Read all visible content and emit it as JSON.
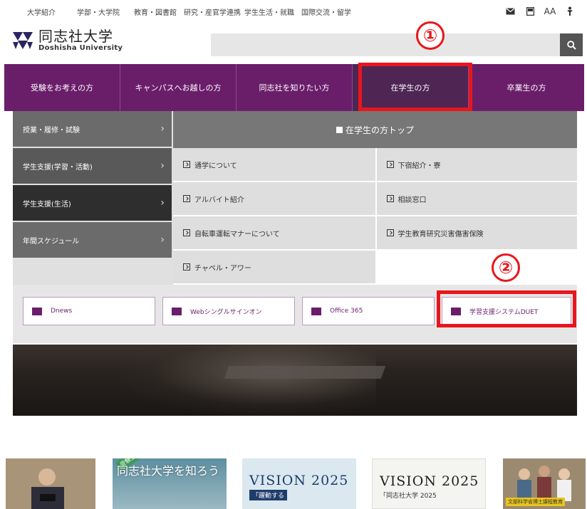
{
  "utility_links": [
    "大学紹介",
    "学部・大学院",
    "教育・図書館",
    "研究・産官学連携",
    "学生生活・就職",
    "国際交流・留学"
  ],
  "utility_icons": [
    "mail-icon",
    "bookmark-icon",
    "font-size-icon",
    "accessibility-icon"
  ],
  "font_size_label": "AA",
  "logo": {
    "ja": "同志社大学",
    "en": "Doshisha University"
  },
  "search": {
    "placeholder": ""
  },
  "main_nav": {
    "items": [
      "受験をお考えの方",
      "キャンパスへお越しの方",
      "同志社を知りたい方",
      "在学生の方",
      "卒業生の方"
    ],
    "active_index": 3
  },
  "annotations": {
    "one": "①",
    "two": "②"
  },
  "side_menu": [
    {
      "label": "授業・履修・試験"
    },
    {
      "label": "学生支援(学習・活動)"
    },
    {
      "label": "学生支援(生活)"
    },
    {
      "label": "年間スケジュール"
    }
  ],
  "top_link": "在学生の方トップ",
  "grid_links": [
    [
      "通学について",
      "下宿紹介・寮"
    ],
    [
      "アルバイト紹介",
      "相談窓口"
    ],
    [
      "自転車運転マナーについて",
      "学生教育研究災害傷害保険"
    ],
    [
      "チャペル・アワー",
      ""
    ]
  ],
  "quick_links": [
    "Dnews",
    "Webシングルサインオン",
    "Office 365",
    "学習支援システムDUET"
  ],
  "banners": {
    "b2_title": "同志社大学を知ろう",
    "b2_tag": "受験生向け",
    "b3_title": "VISION 2025",
    "b3_sub": "「躍動する",
    "b4_title": "VISION 2025",
    "b4_sub": "「同志社大学 2025",
    "b5_tag": "文部科学省博士課程教育"
  },
  "colors": {
    "brand_purple": "#6a1e6a",
    "active_nav": "#4e2553",
    "annotation_red": "#e8161c"
  }
}
